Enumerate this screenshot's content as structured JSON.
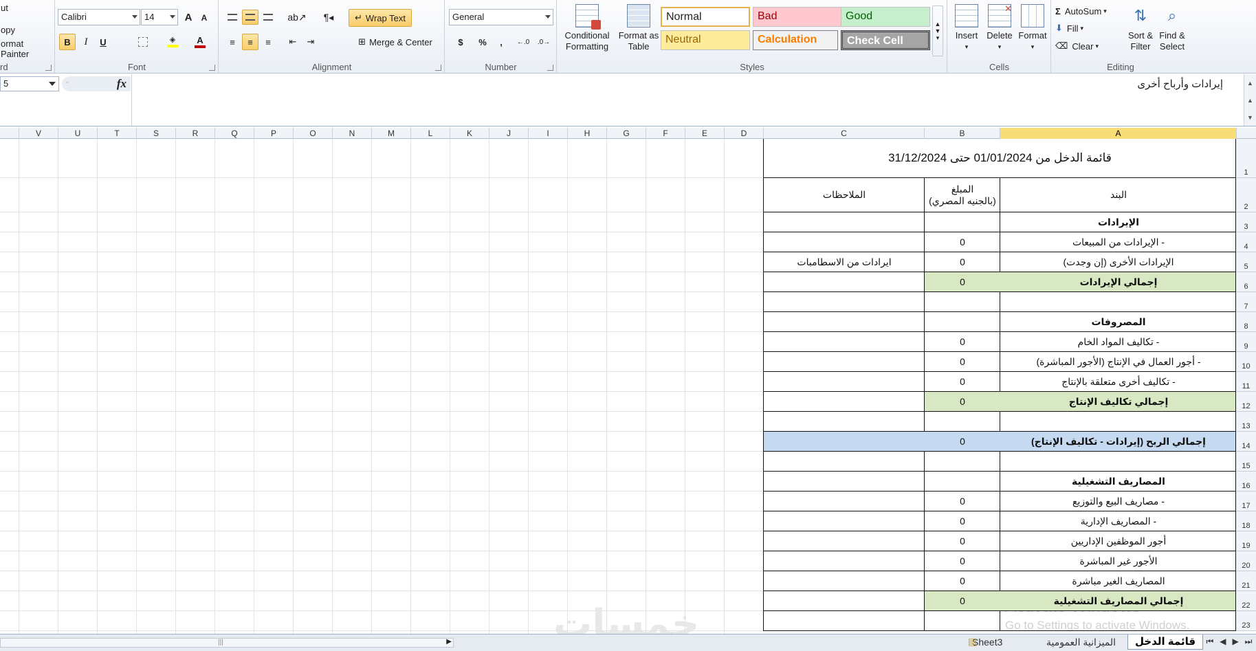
{
  "clipboard": {
    "cut_label": "ut",
    "copy_label": "opy",
    "painter_label": "ormat Painter",
    "group_label": "rd"
  },
  "font": {
    "name": "Calibri",
    "size": "14",
    "group_label": "Font",
    "bold": "B",
    "italic": "I",
    "underline": "U",
    "grow": "A",
    "shrink": "A",
    "font_color": "#c00000",
    "highlight_color": "#ffff00"
  },
  "alignment": {
    "wrap_label": "Wrap Text",
    "merge_label": "Merge & Center",
    "group_label": "Alignment"
  },
  "number": {
    "format": "General",
    "currency": "$",
    "percent": "%",
    "comma": ",",
    "group_label": "Number"
  },
  "styles": {
    "conditional_label_1": "Conditional",
    "conditional_label_2": "Formatting",
    "table_label_1": "Format as",
    "table_label_2": "Table",
    "normal": "Normal",
    "bad": "Bad",
    "good": "Good",
    "neutral": "Neutral",
    "calculation": "Calculation",
    "check_cell": "Check Cell",
    "group_label": "Styles"
  },
  "cells": {
    "insert": "Insert",
    "delete": "Delete",
    "format": "Format",
    "group_label": "Cells"
  },
  "editing": {
    "autosum": "AutoSum",
    "fill": "Fill",
    "clear": "Clear",
    "sort_1": "Sort &",
    "sort_2": "Filter",
    "find_1": "Find &",
    "find_2": "Select",
    "group_label": "Editing"
  },
  "formula_bar": {
    "name_box": "5",
    "fx": "fx",
    "content": "إيرادات وأرباح أخرى"
  },
  "columns": [
    "V",
    "U",
    "T",
    "S",
    "R",
    "Q",
    "P",
    "O",
    "N",
    "M",
    "L",
    "K",
    "J",
    "I",
    "H",
    "G",
    "F",
    "E",
    "D",
    "C",
    "B",
    "A"
  ],
  "sheet": {
    "title": "قائمة الدخل من 01/01/2024 حتى 31/12/2024",
    "header_item": "البند",
    "header_amount_1": "المبلغ",
    "header_amount_2": "(بالجنيه المصري)",
    "header_notes": "الملاحظات",
    "rows": [
      {
        "num": "3",
        "item": "الإيرادات",
        "amount": "",
        "note": "",
        "style": "bold"
      },
      {
        "num": "4",
        "item": "- الإيرادات من المبيعات",
        "amount": "0",
        "note": "",
        "style": ""
      },
      {
        "num": "5",
        "item": "الإيرادات الأخرى (إن وجدت)",
        "amount": "0",
        "note": "ايرادات من الاسطامبات",
        "style": ""
      },
      {
        "num": "6",
        "item": "إجمالي الإيرادات",
        "amount": "0",
        "note": "",
        "style": "green"
      },
      {
        "num": "7",
        "item": "",
        "amount": "",
        "note": "",
        "style": ""
      },
      {
        "num": "8",
        "item": "المصروفات",
        "amount": "",
        "note": "",
        "style": "bold"
      },
      {
        "num": "9",
        "item": "- تكاليف المواد الخام",
        "amount": "0",
        "note": "",
        "style": ""
      },
      {
        "num": "10",
        "item": "- أجور العمال في الإنتاج (الأجور المباشرة)",
        "amount": "0",
        "note": "",
        "style": ""
      },
      {
        "num": "11",
        "item": "- تكاليف أخرى متعلقة بالإنتاج",
        "amount": "0",
        "note": "",
        "style": ""
      },
      {
        "num": "12",
        "item": "إجمالي تكاليف الإنتاج",
        "amount": "0",
        "note": "",
        "style": "green"
      },
      {
        "num": "13",
        "item": "",
        "amount": "",
        "note": "",
        "style": ""
      },
      {
        "num": "14",
        "item": "إجمالي الربح (إيرادات - تكاليف الإنتاج)",
        "amount": "0",
        "note": "",
        "style": "blue"
      },
      {
        "num": "15",
        "item": "",
        "amount": "",
        "note": "",
        "style": ""
      },
      {
        "num": "16",
        "item": "المصاريف التشغيلية",
        "amount": "",
        "note": "",
        "style": "bold"
      },
      {
        "num": "17",
        "item": "- مصاريف البيع والتوزيع",
        "amount": "0",
        "note": "",
        "style": ""
      },
      {
        "num": "18",
        "item": "- المصاريف الإدارية",
        "amount": "0",
        "note": "",
        "style": ""
      },
      {
        "num": "19",
        "item": "أجور الموظفين الإداريين",
        "amount": "0",
        "note": "",
        "style": ""
      },
      {
        "num": "20",
        "item": "الأجور غير المباشرة",
        "amount": "0",
        "note": "",
        "style": ""
      },
      {
        "num": "21",
        "item": "المصاريف الغير مباشرة",
        "amount": "0",
        "note": "",
        "style": ""
      },
      {
        "num": "22",
        "item": "إجمالي المصاريف التشغيلية",
        "amount": "0",
        "note": "",
        "style": "green"
      },
      {
        "num": "23",
        "item": "",
        "amount": "",
        "note": "",
        "style": ""
      }
    ],
    "title_row_num": "1",
    "header_row_num": "2"
  },
  "tabs": [
    "قائمة الدخل",
    "الميزانية العمومية",
    "Sheet3"
  ],
  "watermark_1": "Activate Windows",
  "watermark_2": "Go to Settings to activate Windows.",
  "brand_watermark": "خمسات"
}
